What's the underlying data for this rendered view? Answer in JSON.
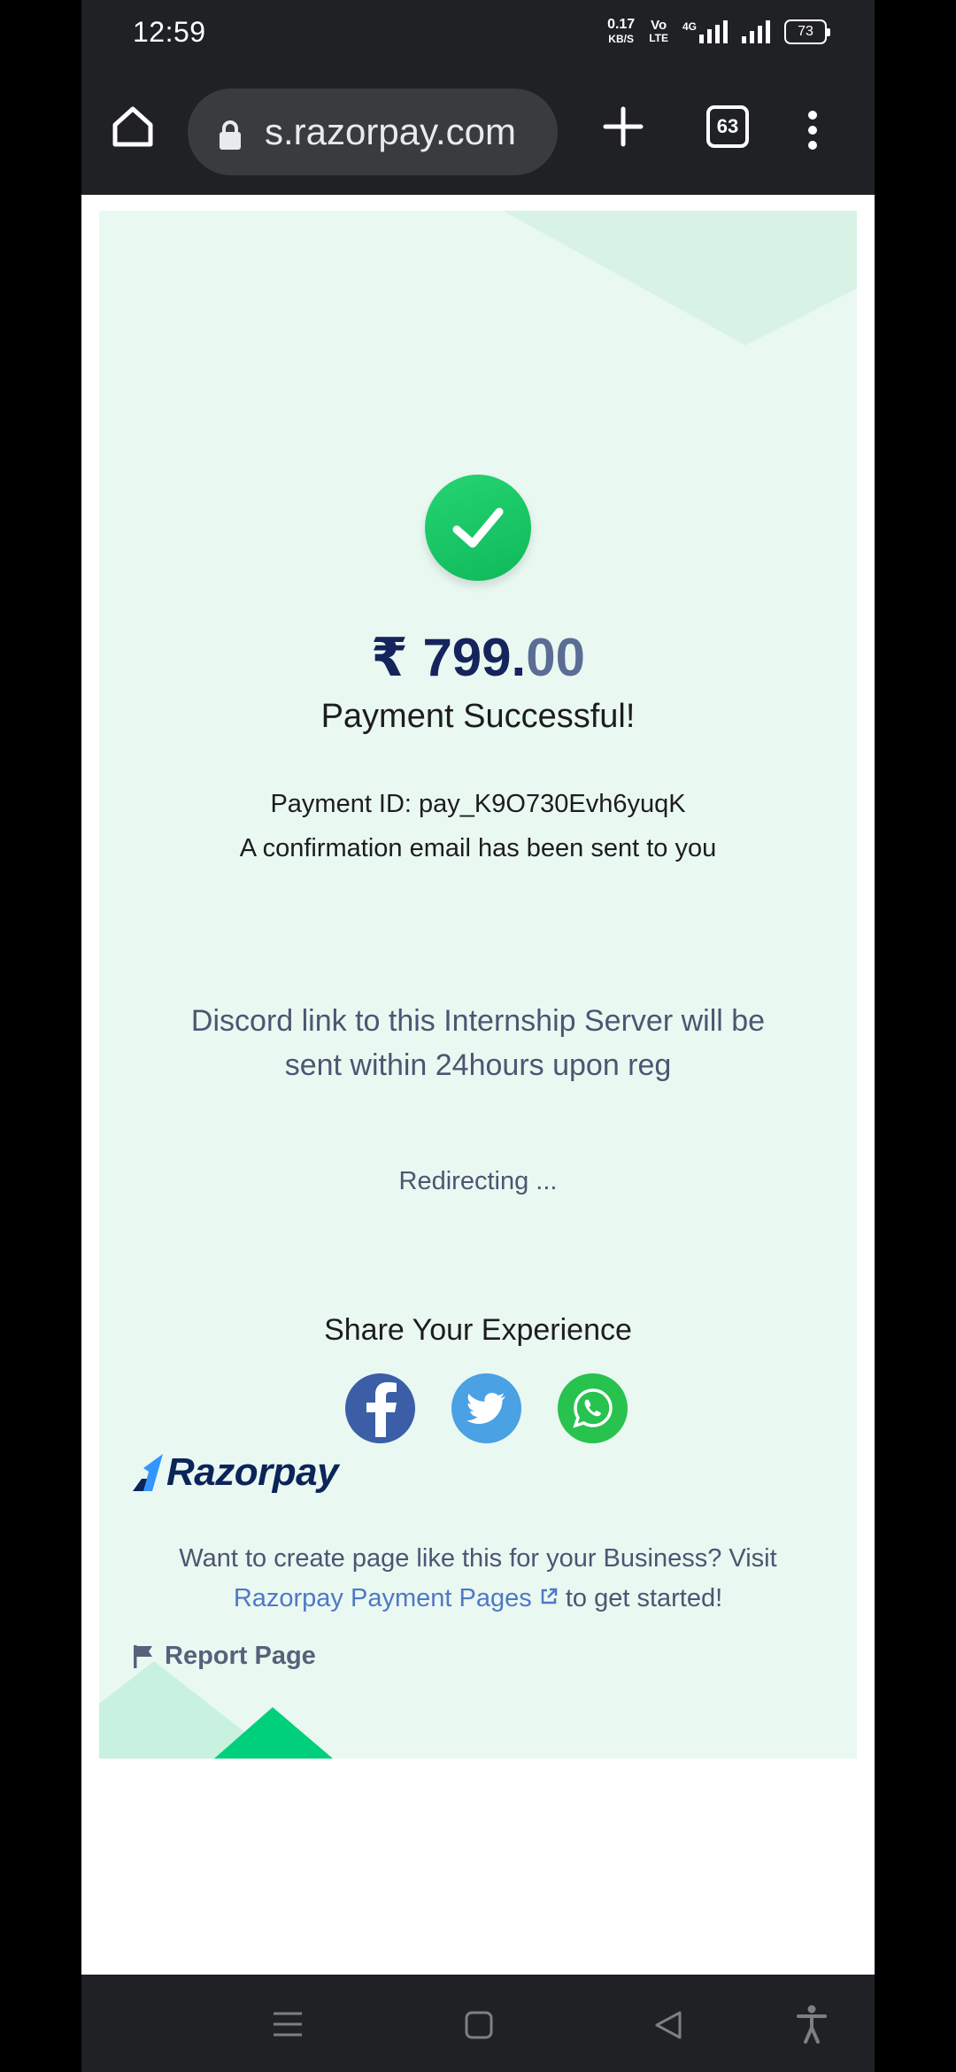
{
  "status_bar": {
    "time": "12:59",
    "net_speed_value": "0.17",
    "net_speed_unit": "KB/S",
    "volte_top": "Vo",
    "volte_bottom": "LTE",
    "network": "4G",
    "battery": "73"
  },
  "browser": {
    "url": "s.razorpay.com",
    "tab_count": "63"
  },
  "payment": {
    "currency_symbol": "₹",
    "amount_main": "799.",
    "amount_decimal": "00",
    "status_title": "Payment Successful!",
    "payment_id": "Payment ID: pay_K9O730Evh6yuqK",
    "email_note": "A confirmation email has been sent to you",
    "description": "Discord link to this Internship Server will be sent within 24hours upon reg",
    "redirect_text": "Redirecting ..."
  },
  "share": {
    "title": "Share Your Experience",
    "buttons": [
      {
        "icon": "facebook-icon",
        "color": "#3b5ea7"
      },
      {
        "icon": "twitter-icon",
        "color": "#4aa1e3"
      },
      {
        "icon": "whatsapp-icon",
        "color": "#28c24f"
      }
    ]
  },
  "footer": {
    "brand": "Razorpay",
    "promo_text": "Want to create page like this for your Business? Visit",
    "promo_link": "Razorpay Payment Pages",
    "promo_suffix": "to get started!",
    "report_label": "Report Page"
  },
  "colors": {
    "accent_green": "#19c466",
    "brand_navy": "#0b2459",
    "page_background": "#eaf8f2",
    "link": "#4f78c6"
  }
}
